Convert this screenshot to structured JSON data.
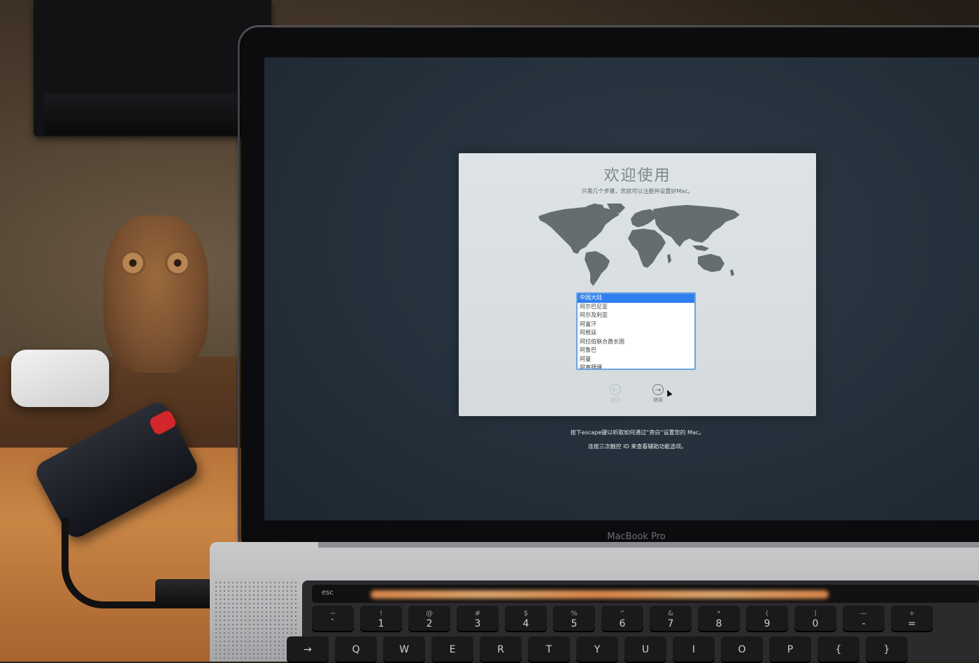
{
  "setup": {
    "title": "欢迎使用",
    "subtitle": "只需几个步骤，您就可以注册并设置好Mac。",
    "countries": [
      {
        "label": "中国大陆",
        "selected": true
      },
      {
        "label": "阿尔巴尼亚",
        "selected": false
      },
      {
        "label": "阿尔及利亚",
        "selected": false
      },
      {
        "label": "阿富汗",
        "selected": false
      },
      {
        "label": "阿根廷",
        "selected": false
      },
      {
        "label": "阿拉伯联合酋长国",
        "selected": false
      },
      {
        "label": "阿鲁巴",
        "selected": false
      },
      {
        "label": "阿曼",
        "selected": false
      },
      {
        "label": "阿塞拜疆",
        "selected": false
      }
    ],
    "back_label": "返回",
    "continue_label": "继续"
  },
  "hints": {
    "escape": "按下escape键以听取如何通过“旁白”设置您的 Mac。",
    "touch_id": "连按三次触控 ID 来查看辅助功能选项。"
  },
  "laptop": {
    "model": "MacBook Pro",
    "esc_label": "esc"
  },
  "keyboard": {
    "number_row": [
      {
        "top": "~",
        "main": "`"
      },
      {
        "top": "!",
        "main": "1"
      },
      {
        "top": "@",
        "main": "2"
      },
      {
        "top": "#",
        "main": "3"
      },
      {
        "top": "$",
        "main": "4"
      },
      {
        "top": "%",
        "main": "5"
      },
      {
        "top": "^",
        "main": "6"
      },
      {
        "top": "&",
        "main": "7"
      },
      {
        "top": "*",
        "main": "8"
      },
      {
        "top": "(",
        "main": "9"
      },
      {
        "top": ")",
        "main": "0"
      },
      {
        "top": "—",
        "main": "-"
      },
      {
        "top": "+",
        "main": "="
      }
    ],
    "letter_row": [
      "→",
      "Q",
      "W",
      "E",
      "R",
      "T",
      "Y",
      "U",
      "I",
      "O",
      "P",
      "{",
      "}"
    ]
  },
  "colors": {
    "screen_bg": "#26323d",
    "window_bg": "#dde3e6",
    "selection": "#2f7ff0",
    "touchbar_glow": "#ff9b55"
  }
}
